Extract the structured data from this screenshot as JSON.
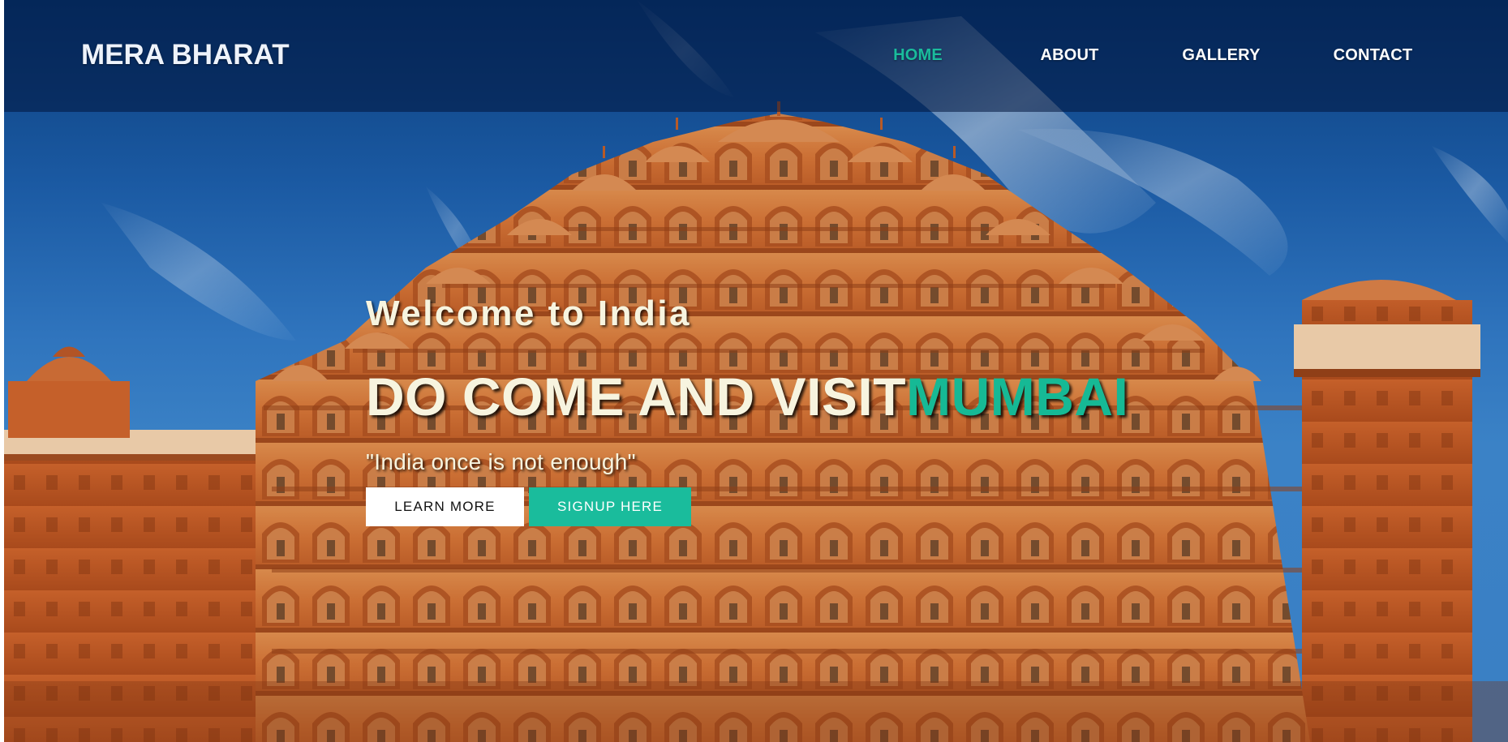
{
  "brand": {
    "title": "MERA BHARAT"
  },
  "nav": {
    "items": [
      {
        "label": "HOME",
        "active": true
      },
      {
        "label": "ABOUT",
        "active": false
      },
      {
        "label": "GALLERY",
        "active": false
      },
      {
        "label": "CONTACT",
        "active": false
      }
    ]
  },
  "hero": {
    "welcome": "Welcome to India",
    "headline_prefix": "DO COME AND VISIT",
    "headline_city": "MUMBAI",
    "tagline": "\"India once is not enough\"",
    "learn_more_label": "LEARN MORE",
    "signup_label": "SIGNUP HERE",
    "background_image": "hawa-mahal-palace"
  },
  "colors": {
    "accent": "#1abc9c",
    "text_light": "#f7f4df",
    "navbar_bg": "#0a2550"
  }
}
